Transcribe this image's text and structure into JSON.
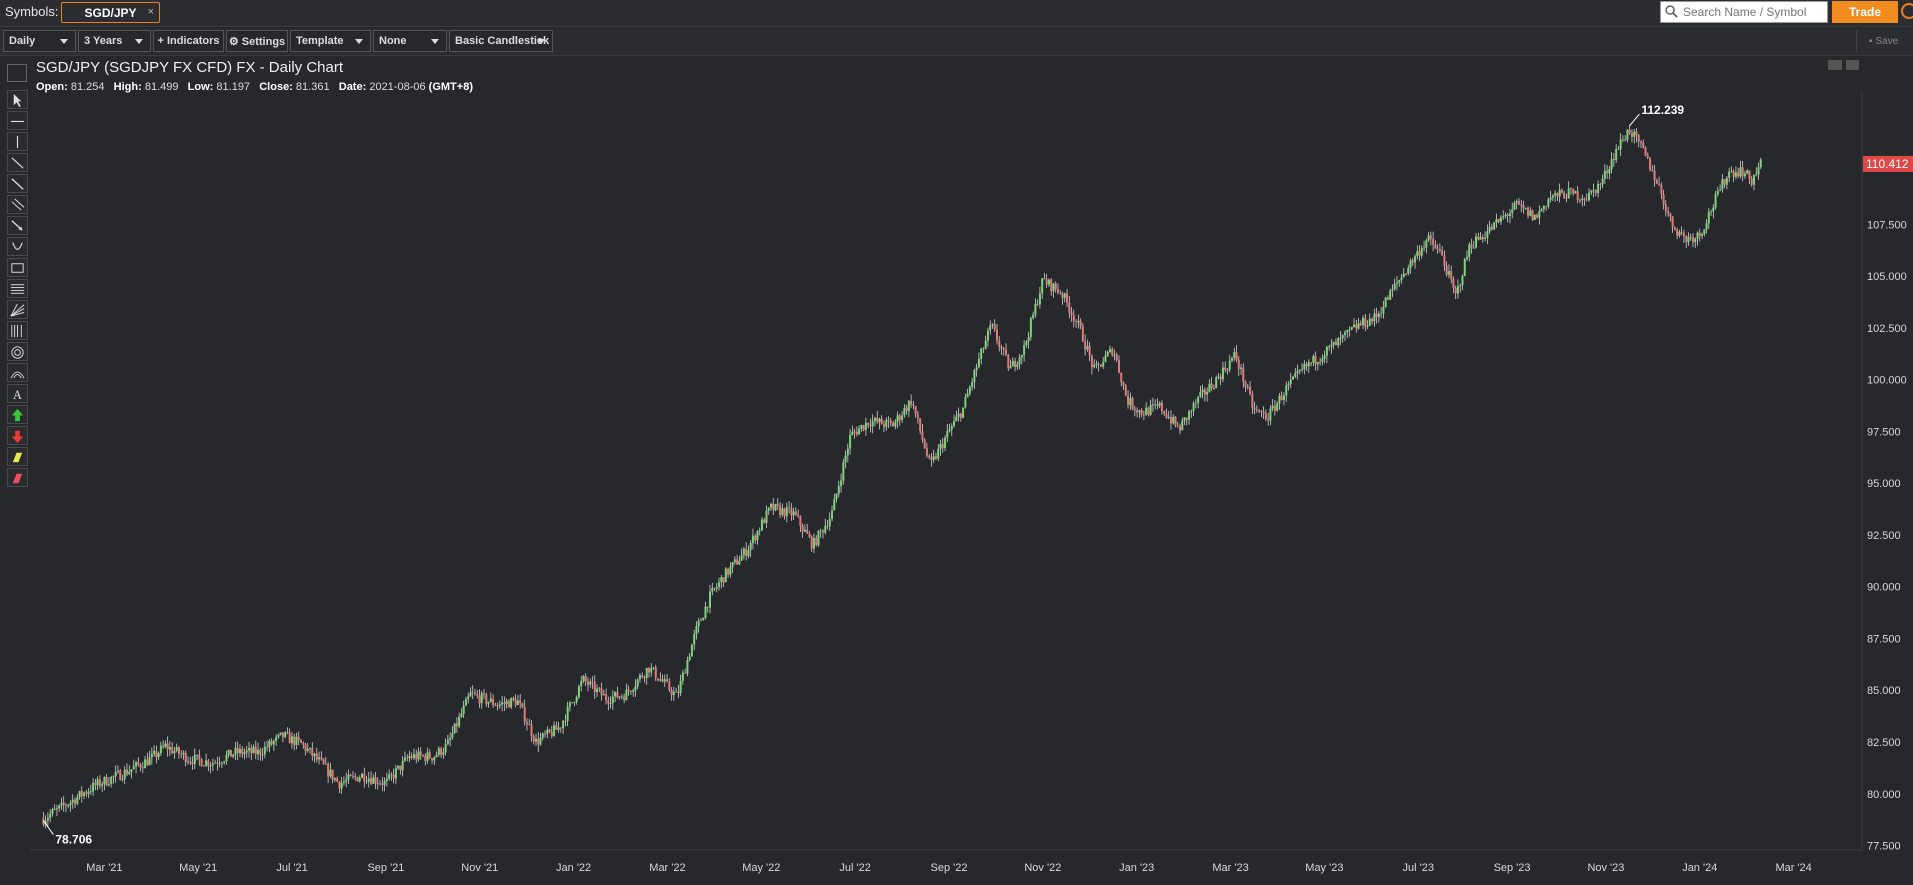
{
  "topbar": {
    "symbols_label": "Symbols:",
    "symbol_tag": "SGD/JPY",
    "close_glyph": "×",
    "search_placeholder": "Search Name / Symbol",
    "trade_label": "Trade"
  },
  "toolbar": {
    "interval": "Daily",
    "range": "3 Years",
    "indicators_label": "+ Indicators",
    "settings_label": "⚙ Settings",
    "template": "Template",
    "compare": "None",
    "chart_style": "Basic Candlestick",
    "save_label": "Save"
  },
  "chart_header": {
    "title": "SGD/JPY (SGDJPY FX CFD) FX - Daily Chart",
    "open_label": "Open:",
    "open": "81.254",
    "high_label": "High:",
    "high": "81.499",
    "low_label": "Low:",
    "low": "81.197",
    "close_label": "Close:",
    "close": "81.361",
    "date_label": "Date:",
    "date": "2021-08-06",
    "tz": "(GMT+8)"
  },
  "drawing_tools": [
    "cursor-icon",
    "horizontal-line-icon",
    "vertical-line-icon",
    "trend-line-icon",
    "ray-line-icon",
    "parallel-channel-icon",
    "arrow-line-icon",
    "arc-icon",
    "rectangle-icon",
    "fib-retracement-icon",
    "fib-fan-icon",
    "fib-timezone-icon",
    "fib-circle-icon",
    "fib-arc-icon",
    "text-icon",
    "arrow-up-icon",
    "arrow-down-icon",
    "highlighter-icon",
    "eraser-icon"
  ],
  "colors": {
    "up": "#7bd37a",
    "down": "#e07a7a",
    "last_price_bg": "#e04848",
    "accent": "#f28c1f"
  },
  "chart_data": {
    "type": "candlestick",
    "y_ticks": [
      "77.500",
      "80.000",
      "82.500",
      "85.000",
      "87.500",
      "90.000",
      "92.500",
      "95.000",
      "97.500",
      "100.000",
      "102.500",
      "105.000",
      "107.500"
    ],
    "y_tick_values": [
      77.5,
      80,
      82.5,
      85,
      87.5,
      90,
      92.5,
      95,
      97.5,
      100,
      102.5,
      105,
      107.5
    ],
    "ylim": [
      76.9,
      113.5
    ],
    "x_ticks": [
      "Mar '21",
      "May '21",
      "Jul '21",
      "Sep '21",
      "Nov '21",
      "Jan '22",
      "Mar '22",
      "May '22",
      "Jul '22",
      "Sep '22",
      "Nov '22",
      "Jan '23",
      "Mar '23",
      "May '23",
      "Jul '23",
      "Sep '23",
      "Nov '23",
      "Jan '24",
      "Mar '24"
    ],
    "x_tick_positions": [
      1,
      3,
      5,
      7,
      9,
      11,
      13,
      15,
      17,
      19,
      21,
      23,
      25,
      27,
      29,
      31,
      33,
      35,
      37
    ],
    "xlim": [
      -0.5,
      38.5
    ],
    "price_path": [
      [
        -0.3,
        78.8
      ],
      [
        0.2,
        79.5
      ],
      [
        0.8,
        80.4
      ],
      [
        1.5,
        81.1
      ],
      [
        2.0,
        81.7
      ],
      [
        2.3,
        82.3
      ],
      [
        2.8,
        81.7
      ],
      [
        3.3,
        81.5
      ],
      [
        3.8,
        82.0
      ],
      [
        4.3,
        82.0
      ],
      [
        4.8,
        82.8
      ],
      [
        5.2,
        82.4
      ],
      [
        5.6,
        81.5
      ],
      [
        6.0,
        80.5
      ],
      [
        6.5,
        80.9
      ],
      [
        7.0,
        80.5
      ],
      [
        7.5,
        81.8
      ],
      [
        8.0,
        81.8
      ],
      [
        8.3,
        82.3
      ],
      [
        8.8,
        84.8
      ],
      [
        9.4,
        84.3
      ],
      [
        9.8,
        84.5
      ],
      [
        10.2,
        82.5
      ],
      [
        10.7,
        83.2
      ],
      [
        11.2,
        85.5
      ],
      [
        11.7,
        84.6
      ],
      [
        12.1,
        84.8
      ],
      [
        12.6,
        86.1
      ],
      [
        13.2,
        84.7
      ],
      [
        13.6,
        87.8
      ],
      [
        13.9,
        89.5
      ],
      [
        14.2,
        90.5
      ],
      [
        14.7,
        91.8
      ],
      [
        15.2,
        93.8
      ],
      [
        15.7,
        93.5
      ],
      [
        16.1,
        92.0
      ],
      [
        16.5,
        93.5
      ],
      [
        16.9,
        97.3
      ],
      [
        17.3,
        98.0
      ],
      [
        17.8,
        97.8
      ],
      [
        18.2,
        99.0
      ],
      [
        18.6,
        95.8
      ],
      [
        19.0,
        97.5
      ],
      [
        19.3,
        98.6
      ],
      [
        19.6,
        100.7
      ],
      [
        19.9,
        102.6
      ],
      [
        20.3,
        100.5
      ],
      [
        20.6,
        101.5
      ],
      [
        21.0,
        104.8
      ],
      [
        21.4,
        104.2
      ],
      [
        21.8,
        102.4
      ],
      [
        22.1,
        100.4
      ],
      [
        22.5,
        101.5
      ],
      [
        22.8,
        99.0
      ],
      [
        23.1,
        98.4
      ],
      [
        23.5,
        98.7
      ],
      [
        23.9,
        97.6
      ],
      [
        24.3,
        99.0
      ],
      [
        24.7,
        100.0
      ],
      [
        25.1,
        101.2
      ],
      [
        25.5,
        98.5
      ],
      [
        25.8,
        98.2
      ],
      [
        26.2,
        99.6
      ],
      [
        26.6,
        100.6
      ],
      [
        27.0,
        101.3
      ],
      [
        27.3,
        101.8
      ],
      [
        27.7,
        102.6
      ],
      [
        28.1,
        103.0
      ],
      [
        28.5,
        104.5
      ],
      [
        28.8,
        105.5
      ],
      [
        29.2,
        106.8
      ],
      [
        29.5,
        106.0
      ],
      [
        29.8,
        104.0
      ],
      [
        30.1,
        106.5
      ],
      [
        30.4,
        107.0
      ],
      [
        30.8,
        107.8
      ],
      [
        31.1,
        108.4
      ],
      [
        31.5,
        107.8
      ],
      [
        31.8,
        108.8
      ],
      [
        32.2,
        109.0
      ],
      [
        32.6,
        108.8
      ],
      [
        32.9,
        109.5
      ],
      [
        33.2,
        111.0
      ],
      [
        33.5,
        112.1
      ],
      [
        33.8,
        111.0
      ],
      [
        34.1,
        109.5
      ],
      [
        34.4,
        107.5
      ],
      [
        34.7,
        106.8
      ],
      [
        35.0,
        107.0
      ],
      [
        35.3,
        108.5
      ],
      [
        35.6,
        110.0
      ],
      [
        35.9,
        110.1
      ],
      [
        36.1,
        109.6
      ],
      [
        36.3,
        110.4
      ]
    ],
    "max_label": "112.239",
    "max_point": [
      33.5,
      112.239
    ],
    "min_label": "78.706",
    "min_point": [
      -0.3,
      78.706
    ],
    "last_price": "110.412",
    "last_value": 110.412,
    "grid": false
  }
}
